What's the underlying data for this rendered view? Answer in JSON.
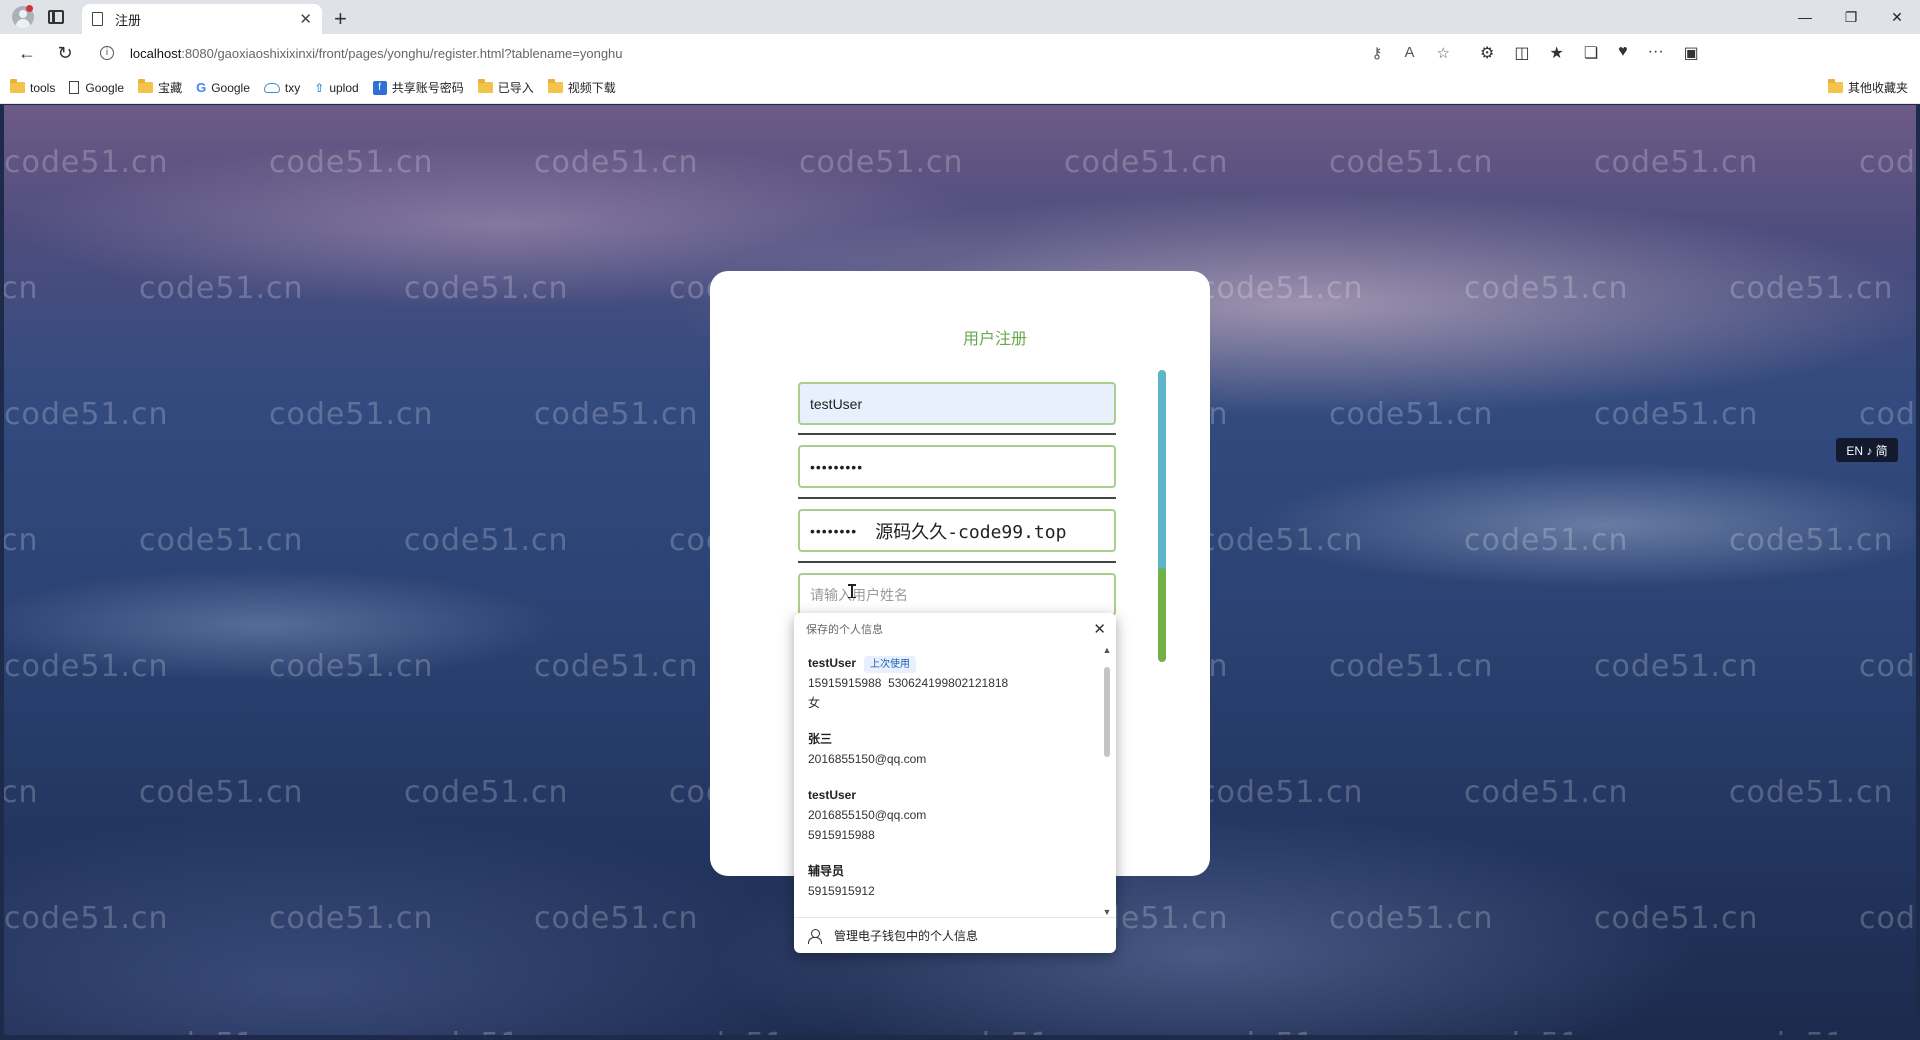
{
  "browser": {
    "tab_title": "注册",
    "url_host": "localhost",
    "url_path": ":8080/gaoxiaoshixixinxi/front/pages/yonghu/register.html?tablename=yonghu",
    "bookmarks": [
      {
        "icon": "folder-icon",
        "label": "tools"
      },
      {
        "icon": "doc-icon",
        "label": "Google"
      },
      {
        "icon": "folder-icon",
        "label": "宝藏"
      },
      {
        "icon": "g-icon",
        "label": "Google"
      },
      {
        "icon": "cloud-icon",
        "label": "txy"
      },
      {
        "icon": "upload-icon",
        "label": "uplod"
      },
      {
        "icon": "share-icon",
        "label": "共享账号密码"
      },
      {
        "icon": "folder-icon",
        "label": "已导入"
      },
      {
        "icon": "folder-icon",
        "label": "视频下载"
      }
    ],
    "other_bookmarks": "其他收藏夹"
  },
  "page": {
    "watermark_text": "code51.cn",
    "lang_toggle": "EN ♪ 简"
  },
  "form": {
    "title": "用户注册",
    "username_value": "testUser",
    "password_value": "•••••••••",
    "confirm_value": "••••••••",
    "confirm_overlay": "源码久久-code99.top",
    "name_placeholder": "请输入用户姓名"
  },
  "autofill": {
    "header": "保存的个人信息",
    "items": [
      {
        "name": "testUser",
        "badge": "上次使用",
        "lines": [
          "15915915988  530624199802121818",
          "女"
        ]
      },
      {
        "name": "张三",
        "badge": "",
        "lines": [
          "2016855150@qq.com"
        ]
      },
      {
        "name": "testUser",
        "badge": "",
        "lines": [
          "2016855150@qq.com",
          "5915915988"
        ]
      },
      {
        "name": "辅导员",
        "badge": "",
        "lines": [
          "5915915912"
        ]
      }
    ],
    "footer": "管理电子钱包中的个人信息"
  },
  "colors": {
    "accent_green": "#6aa84f",
    "field_border": "#a6d08c",
    "scroll_teal": "#5ab6c8",
    "scroll_green": "#74b04a"
  }
}
